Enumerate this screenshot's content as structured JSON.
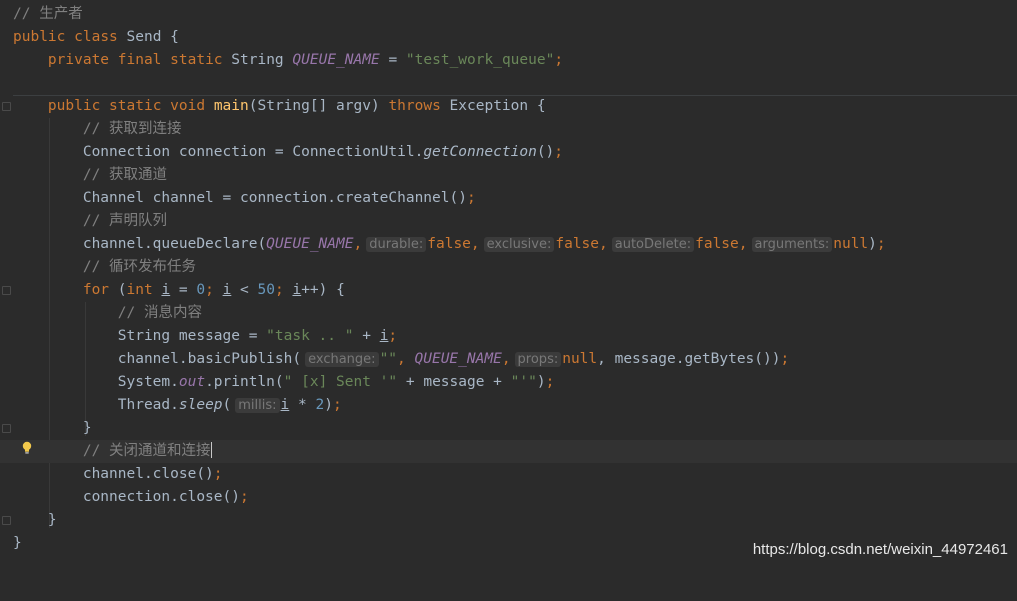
{
  "code": {
    "l1_comment": "// 生产者",
    "l2": {
      "kw1": "public",
      "kw2": "class",
      "name": "Send",
      "brace": " {"
    },
    "l3": {
      "kw1": "private",
      "kw2": "final",
      "kw3": "static",
      "type": "String",
      "field": "QUEUE_NAME",
      "eq": " = ",
      "value": "\"test_work_queue\"",
      "semi": ";"
    },
    "l5": {
      "kw1": "public",
      "kw2": "static",
      "kw3": "void",
      "method": "main",
      "params": "(String[] argv) ",
      "kw4": "throws",
      "rest": " Exception {"
    },
    "l6_comment": "// 获取到连接",
    "l7": {
      "pre": "Connection connection = ConnectionUtil.",
      "call": "getConnection",
      "post": "()",
      "semi": ";"
    },
    "l8_comment": "// 获取通道",
    "l9": {
      "pre": "Channel channel = connection.createChannel()",
      "semi": ";"
    },
    "l10_comment": "// 声明队列",
    "l11": {
      "pre": "channel.queueDeclare(",
      "field": "QUEUE_NAME",
      "comma": ",",
      "hint1": "durable:",
      "v1": "false",
      "hint2": "exclusive:",
      "v2": "false",
      "hint3": "autoDelete:",
      "v3": "false",
      "hint4": "arguments:",
      "v4": "null",
      "end": ")",
      "semi": ";"
    },
    "l12_comment": "// 循环发布任务",
    "l13": {
      "kw": "for",
      "open": " (",
      "kw2": "int",
      "var": "i",
      "eq": " = ",
      "n0": "0",
      "semi1": "; ",
      "var2": "i",
      "lt": " < ",
      "n50": "50",
      "semi2": "; ",
      "var3": "i",
      "inc": "++) {"
    },
    "l14_comment": "// 消息内容",
    "l15": {
      "pre": "String message = ",
      "str": "\"task .. \"",
      "plus": " + ",
      "var": "i",
      "semi": ";"
    },
    "l16": {
      "pre": "channel.basicPublish(",
      "hint1": "exchange:",
      "v1": "\"\"",
      "comma1": ", ",
      "field": "QUEUE_NAME",
      "comma2": ",",
      "hint2": "props:",
      "v2": "null",
      "rest": ", message.getBytes())",
      "semi": ";"
    },
    "l17": {
      "pre": "System.",
      "field": "out",
      "mid": ".println(",
      "s1": "\" [x] Sent '\"",
      "plus1": " + message + ",
      "s2": "\"'\"",
      "end": ")",
      "semi": ";"
    },
    "l18": {
      "pre": "Thread.",
      "call": "sleep",
      "open": "(",
      "hint": "millis:",
      "var": "i",
      "rest": " * ",
      "n2": "2",
      "end": ")",
      "semi": ";"
    },
    "l19": "}",
    "l20_comment": "// 关闭通道和连接",
    "l21": {
      "pre": "channel.close()",
      "semi": ";"
    },
    "l22": {
      "pre": "connection.close()",
      "semi": ";"
    },
    "l23": "}",
    "l24": "}"
  },
  "watermark": "https://blog.csdn.net/weixin_44972461",
  "colors": {
    "background": "#2b2b2b",
    "keyword": "#cc7832",
    "string": "#6a8759",
    "number": "#6897bb",
    "comment": "#808080",
    "field": "#9876aa",
    "method": "#ffc66d"
  },
  "icons": {
    "bulb": "lightbulb-icon",
    "fold": "fold-marker-icon"
  }
}
